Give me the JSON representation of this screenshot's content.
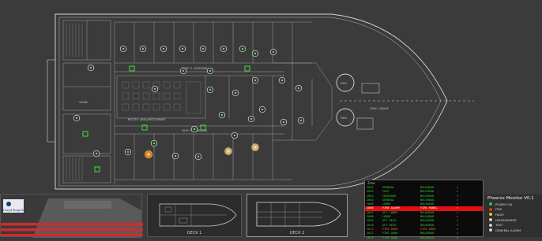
{
  "plan": {
    "corridors": [
      "SHIP'S CORRIDOR",
      "SHIP'S CORRIDOR",
      "MUSTER AREA/RESTAURANT"
    ],
    "rooms": [
      "POOL",
      "POOL",
      "CREW LOUNGE",
      "SAUNA"
    ],
    "detectors": [
      {
        "status": "normal"
      },
      {
        "status": "normal"
      },
      {
        "status": "normal"
      },
      {
        "status": "normal"
      },
      {
        "status": "normal"
      },
      {
        "status": "normal"
      },
      {
        "status": "normal"
      },
      {
        "status": "normal"
      },
      {
        "status": "normal"
      },
      {
        "status": "normal"
      },
      {
        "status": "normal"
      },
      {
        "status": "normal"
      },
      {
        "status": "normal"
      },
      {
        "status": "normal"
      },
      {
        "status": "normal"
      },
      {
        "status": "normal"
      },
      {
        "status": "normal"
      },
      {
        "status": "normal"
      },
      {
        "status": "normal"
      },
      {
        "status": "normal"
      },
      {
        "status": "normal"
      },
      {
        "status": "normal"
      },
      {
        "status": "normal"
      },
      {
        "status": "normal"
      },
      {
        "status": "normal"
      },
      {
        "status": "normal"
      },
      {
        "status": "normal"
      },
      {
        "status": "normal"
      },
      {
        "status": "normal"
      },
      {
        "status": "normal"
      },
      {
        "status": "normal"
      },
      {
        "status": "fire"
      },
      {
        "status": "fault"
      },
      {
        "status": "fault"
      }
    ]
  },
  "thumbnails": {
    "logo_text": "Lloyd Register",
    "deck1_label": "DECK 1",
    "deck2_label": "DECK 2"
  },
  "event_panel": {
    "title": "Zone",
    "rows": [
      {
        "id": "2601",
        "text": "GENERAL",
        "loc": "BULKHEAD",
        "state": "normal"
      },
      {
        "id": "2602",
        "text": "CAFE",
        "loc": "BULKHEAD",
        "state": "normal"
      },
      {
        "id": "2603",
        "text": "CORRIDOR",
        "loc": "BULKHEAD",
        "state": "normal"
      },
      {
        "id": "2604",
        "text": "GENERAL",
        "loc": "BULKHEAD",
        "state": "normal"
      },
      {
        "id": "2605",
        "text": "LOBBY",
        "loc": "BULKHEAD",
        "state": "normal"
      },
      {
        "id": "2606",
        "text": "FIRE ALARM",
        "loc": "FIRE PANEL",
        "state": "active"
      },
      {
        "id": "2607",
        "text": "AFT LOBBY",
        "loc": "BULKHEAD",
        "state": "normal"
      },
      {
        "id": "2608",
        "text": "LOBBY",
        "loc": "BULKHEAD",
        "state": "normal"
      },
      {
        "id": "2609",
        "text": "AFT DECK",
        "loc": "BULKHEAD",
        "state": "normal"
      },
      {
        "id": "2610",
        "text": "AFT DECK",
        "loc": "BULKHEAD",
        "state": "normal"
      },
      {
        "id": "2611",
        "text": "FIRE DOOR",
        "loc": "FIRE DOOR",
        "state": "alarm"
      },
      {
        "id": "2612",
        "text": "FIRE DOOR",
        "loc": "BULKHEAD",
        "state": "normal"
      },
      {
        "id": "2613",
        "text": "FIRE DOOR",
        "loc": "BULKHEAD",
        "state": "normal"
      }
    ]
  },
  "legend": {
    "title": "Phoenix Monitor V0.1",
    "items": [
      {
        "label": "POWER ON",
        "color": "#2ecc40"
      },
      {
        "label": "FIRE",
        "color": "#e8302a"
      },
      {
        "label": "FAULT",
        "color": "#f0c419"
      },
      {
        "label": "DISABLEMENT",
        "color": "#d0d0d0"
      },
      {
        "label": "TEST",
        "color": "#d0d0d0"
      },
      {
        "label": "GENERAL ALARM",
        "color": "#d0d0d0"
      }
    ]
  }
}
